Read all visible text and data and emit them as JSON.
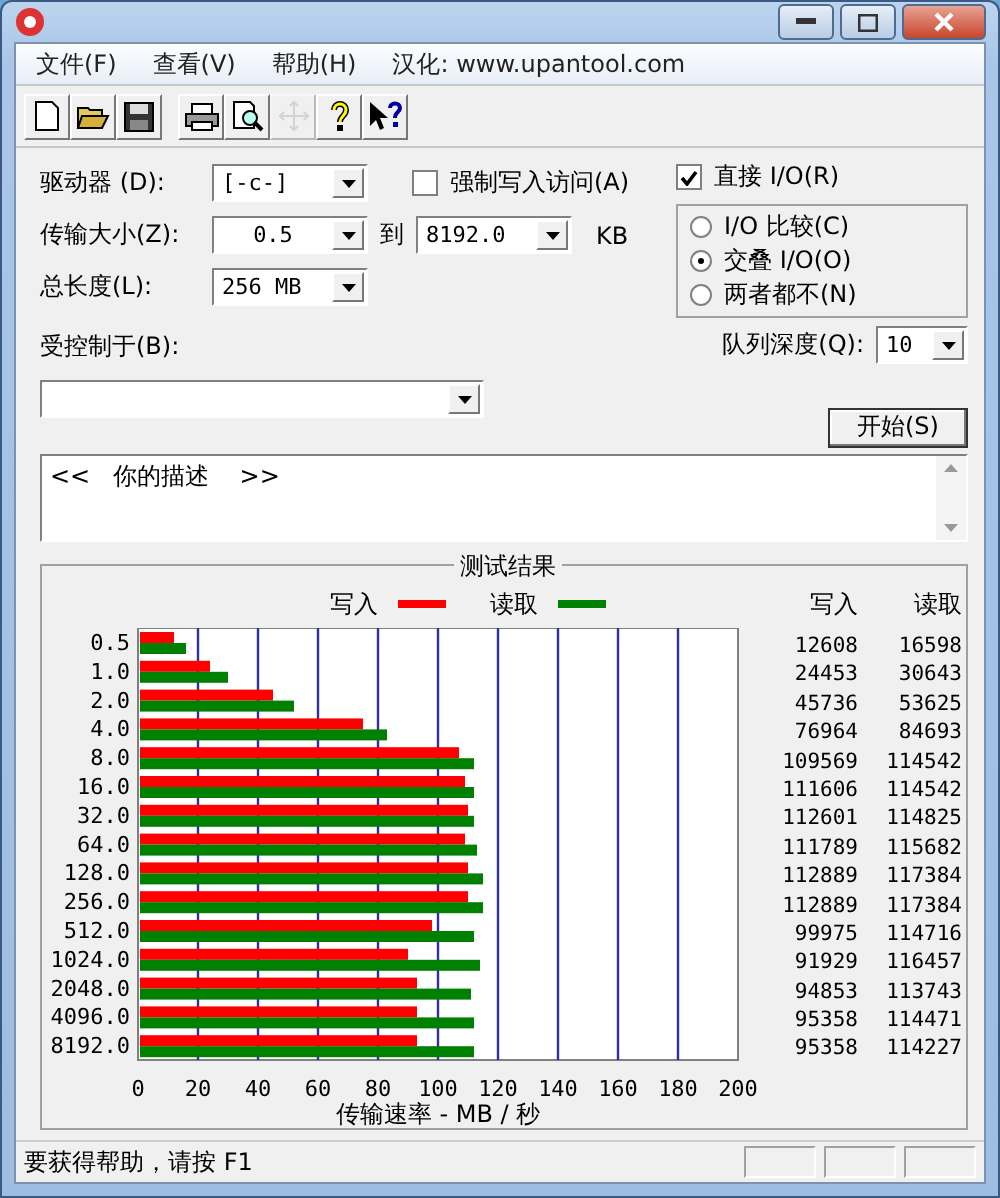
{
  "menu": [
    {
      "label": "文件(F)"
    },
    {
      "label": "查看(V)"
    },
    {
      "label": "帮助(H)"
    },
    {
      "label": "汉化: www.upantool.com"
    }
  ],
  "toolbar": [
    {
      "kind": "new",
      "disabled": false
    },
    {
      "kind": "open",
      "disabled": false
    },
    {
      "kind": "save",
      "disabled": false
    },
    {
      "kind": "print",
      "disabled": false
    },
    {
      "kind": "preview",
      "disabled": false
    },
    {
      "kind": "move",
      "disabled": true
    },
    {
      "kind": "help",
      "disabled": false
    },
    {
      "kind": "context-help",
      "disabled": false
    }
  ],
  "drive": {
    "label": "驱动器 (D):",
    "value": "[-c-]"
  },
  "force_write": {
    "label": "强制写入访问(A)",
    "checked": false
  },
  "direct_io": {
    "label": "直接 I/O(R)",
    "checked": true
  },
  "io_mode": [
    {
      "label": "I/O 比较(C)",
      "selected": false
    },
    {
      "label": "交叠 I/O(O)",
      "selected": true
    },
    {
      "label": "两者都不(N)",
      "selected": false
    }
  ],
  "transfer_size": {
    "label": "传输大小(Z):",
    "from": "0.5",
    "to_label": "到",
    "to": "8192.0",
    "unit": "KB"
  },
  "total_length": {
    "label": "总长度(L):",
    "value": "256 MB"
  },
  "queue_depth": {
    "label": "队列深度(Q):",
    "value": "10"
  },
  "controlled_by": {
    "label": "受控制于(B):"
  },
  "start_button": "开始(S)",
  "description": "<<   你的描述    >>",
  "results": {
    "title": "测试结果",
    "chart_data": {
      "type": "bar",
      "orientation": "horizontal",
      "grid": true,
      "xlabel": "传输速率 - MB / 秒",
      "categories": [
        "0.5",
        "1.0",
        "2.0",
        "4.0",
        "8.0",
        "16.0",
        "32.0",
        "64.0",
        "128.0",
        "256.0",
        "512.0",
        "1024.0",
        "2048.0",
        "4096.0",
        "8192.0"
      ],
      "xlim": [
        0,
        200
      ],
      "xticks": [
        0,
        20,
        40,
        60,
        80,
        100,
        120,
        140,
        160,
        180,
        200
      ],
      "series": [
        {
          "name": "写入",
          "color": "#ff0000",
          "values": [
            12,
            24,
            45,
            75,
            107,
            109,
            110,
            109,
            110,
            110,
            98,
            90,
            93,
            93,
            93
          ]
        },
        {
          "name": "读取",
          "color": "#008000",
          "values": [
            16,
            30,
            52,
            83,
            112,
            112,
            112,
            113,
            115,
            115,
            112,
            114,
            111,
            112,
            112
          ]
        }
      ]
    },
    "table": {
      "columns": [
        "写入",
        "读取"
      ],
      "rows": [
        [
          "12608",
          "16598"
        ],
        [
          "24453",
          "30643"
        ],
        [
          "45736",
          "53625"
        ],
        [
          "76964",
          "84693"
        ],
        [
          "109569",
          "114542"
        ],
        [
          "111606",
          "114542"
        ],
        [
          "112601",
          "114825"
        ],
        [
          "111789",
          "115682"
        ],
        [
          "112889",
          "117384"
        ],
        [
          "112889",
          "117384"
        ],
        [
          "99975",
          "114716"
        ],
        [
          "91929",
          "116457"
        ],
        [
          "94853",
          "113743"
        ],
        [
          "95358",
          "114471"
        ],
        [
          "95358",
          "114227"
        ]
      ]
    }
  },
  "status_bar": "要获得帮助，请按 F1"
}
